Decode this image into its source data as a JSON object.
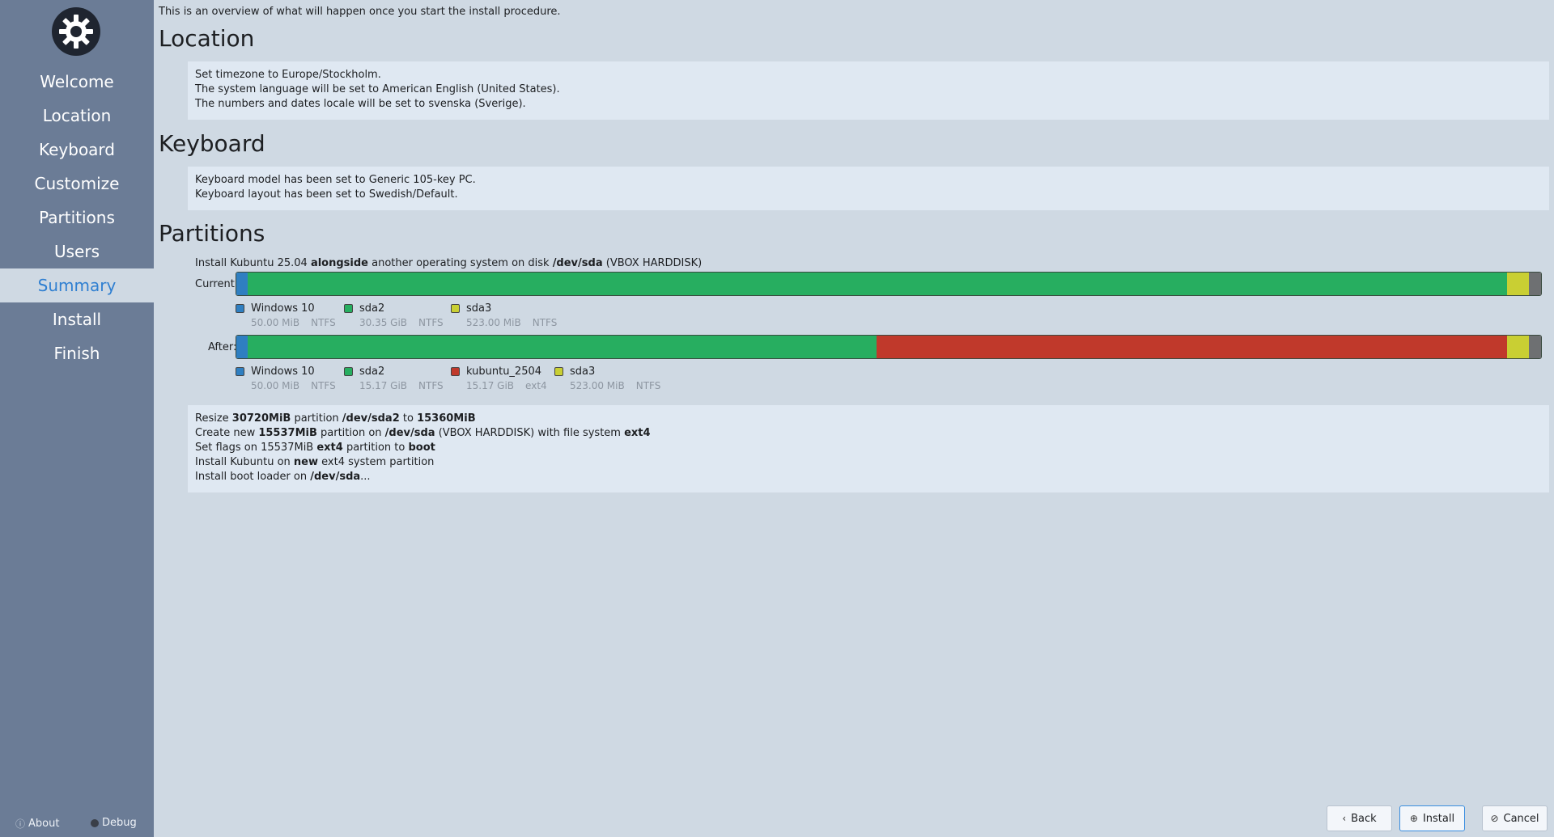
{
  "sidebar": {
    "items": [
      {
        "label": "Welcome",
        "active": false
      },
      {
        "label": "Location",
        "active": false
      },
      {
        "label": "Keyboard",
        "active": false
      },
      {
        "label": "Customize",
        "active": false
      },
      {
        "label": "Partitions",
        "active": false
      },
      {
        "label": "Users",
        "active": false
      },
      {
        "label": "Summary",
        "active": true
      },
      {
        "label": "Install",
        "active": false
      },
      {
        "label": "Finish",
        "active": false
      }
    ],
    "about_label": "About",
    "debug_label": "Debug"
  },
  "intro": "This is an overview of what will happen once you start the install procedure.",
  "location": {
    "title": "Location",
    "lines": [
      "Set timezone to Europe/Stockholm.",
      "The system language will be set to American English (United States).",
      "The numbers and dates locale will be set to svenska (Sverige)."
    ]
  },
  "keyboard": {
    "title": "Keyboard",
    "lines": [
      "Keyboard model has been set to Generic 105-key PC.",
      "Keyboard layout has been set to Swedish/Default."
    ]
  },
  "partitions": {
    "title": "Partitions",
    "desc": {
      "p1": "Install Kubuntu 25.04 ",
      "b1": "alongside",
      "p2": " another operating system on disk ",
      "b2": "/dev/sda",
      "p3": " (VBOX HARDDISK)"
    },
    "current_label": "Current:",
    "after_label": "After:",
    "current": [
      {
        "name": "Windows 10",
        "size": "50.00 MiB",
        "fs": "NTFS",
        "color": "#2f7fc1",
        "share": 0.0085
      },
      {
        "name": "sda2",
        "size": "30.35 GiB",
        "fs": "NTFS",
        "color": "#27ae60",
        "share": 0.9655
      },
      {
        "name": "sda3",
        "size": "523.00 MiB",
        "fs": "NTFS",
        "color": "#c9cf33",
        "share": 0.0165
      },
      {
        "name": "",
        "size": "",
        "fs": "",
        "color": "#6e7072",
        "share": 0.0095
      }
    ],
    "after": [
      {
        "name": "Windows 10",
        "size": "50.00 MiB",
        "fs": "NTFS",
        "color": "#2f7fc1",
        "share": 0.0085
      },
      {
        "name": "sda2",
        "size": "15.17 GiB",
        "fs": "NTFS",
        "color": "#27ae60",
        "share": 0.4823
      },
      {
        "name": "kubuntu_2504",
        "size": "15.17 GiB",
        "fs": "ext4",
        "color": "#c0392b",
        "share": 0.4832
      },
      {
        "name": "sda3",
        "size": "523.00 MiB",
        "fs": "NTFS",
        "color": "#c9cf33",
        "share": 0.0165
      },
      {
        "name": "",
        "size": "",
        "fs": "",
        "color": "#6e7072",
        "share": 0.0095
      }
    ],
    "ops": {
      "l1": {
        "a": "Resize ",
        "b": "30720MiB",
        "c": " partition ",
        "d": "/dev/sda2",
        "e": " to ",
        "f": "15360MiB"
      },
      "l2": {
        "a": "Create new ",
        "b": "15537MiB",
        "c": " partition on ",
        "d": "/dev/sda",
        "e": " (VBOX HARDDISK) with file system ",
        "f": "ext4"
      },
      "l3": {
        "a": "Set flags on 15537MiB ",
        "b": "ext4",
        "c": " partition to ",
        "d": "boot"
      },
      "l4": {
        "a": "Install Kubuntu on ",
        "b": "new",
        "c": " ext4 system partition"
      },
      "l5": {
        "a": "Install boot loader on ",
        "b": "/dev/sda",
        "c": "..."
      }
    }
  },
  "buttons": {
    "back": "Back",
    "install": "Install",
    "cancel": "Cancel"
  }
}
